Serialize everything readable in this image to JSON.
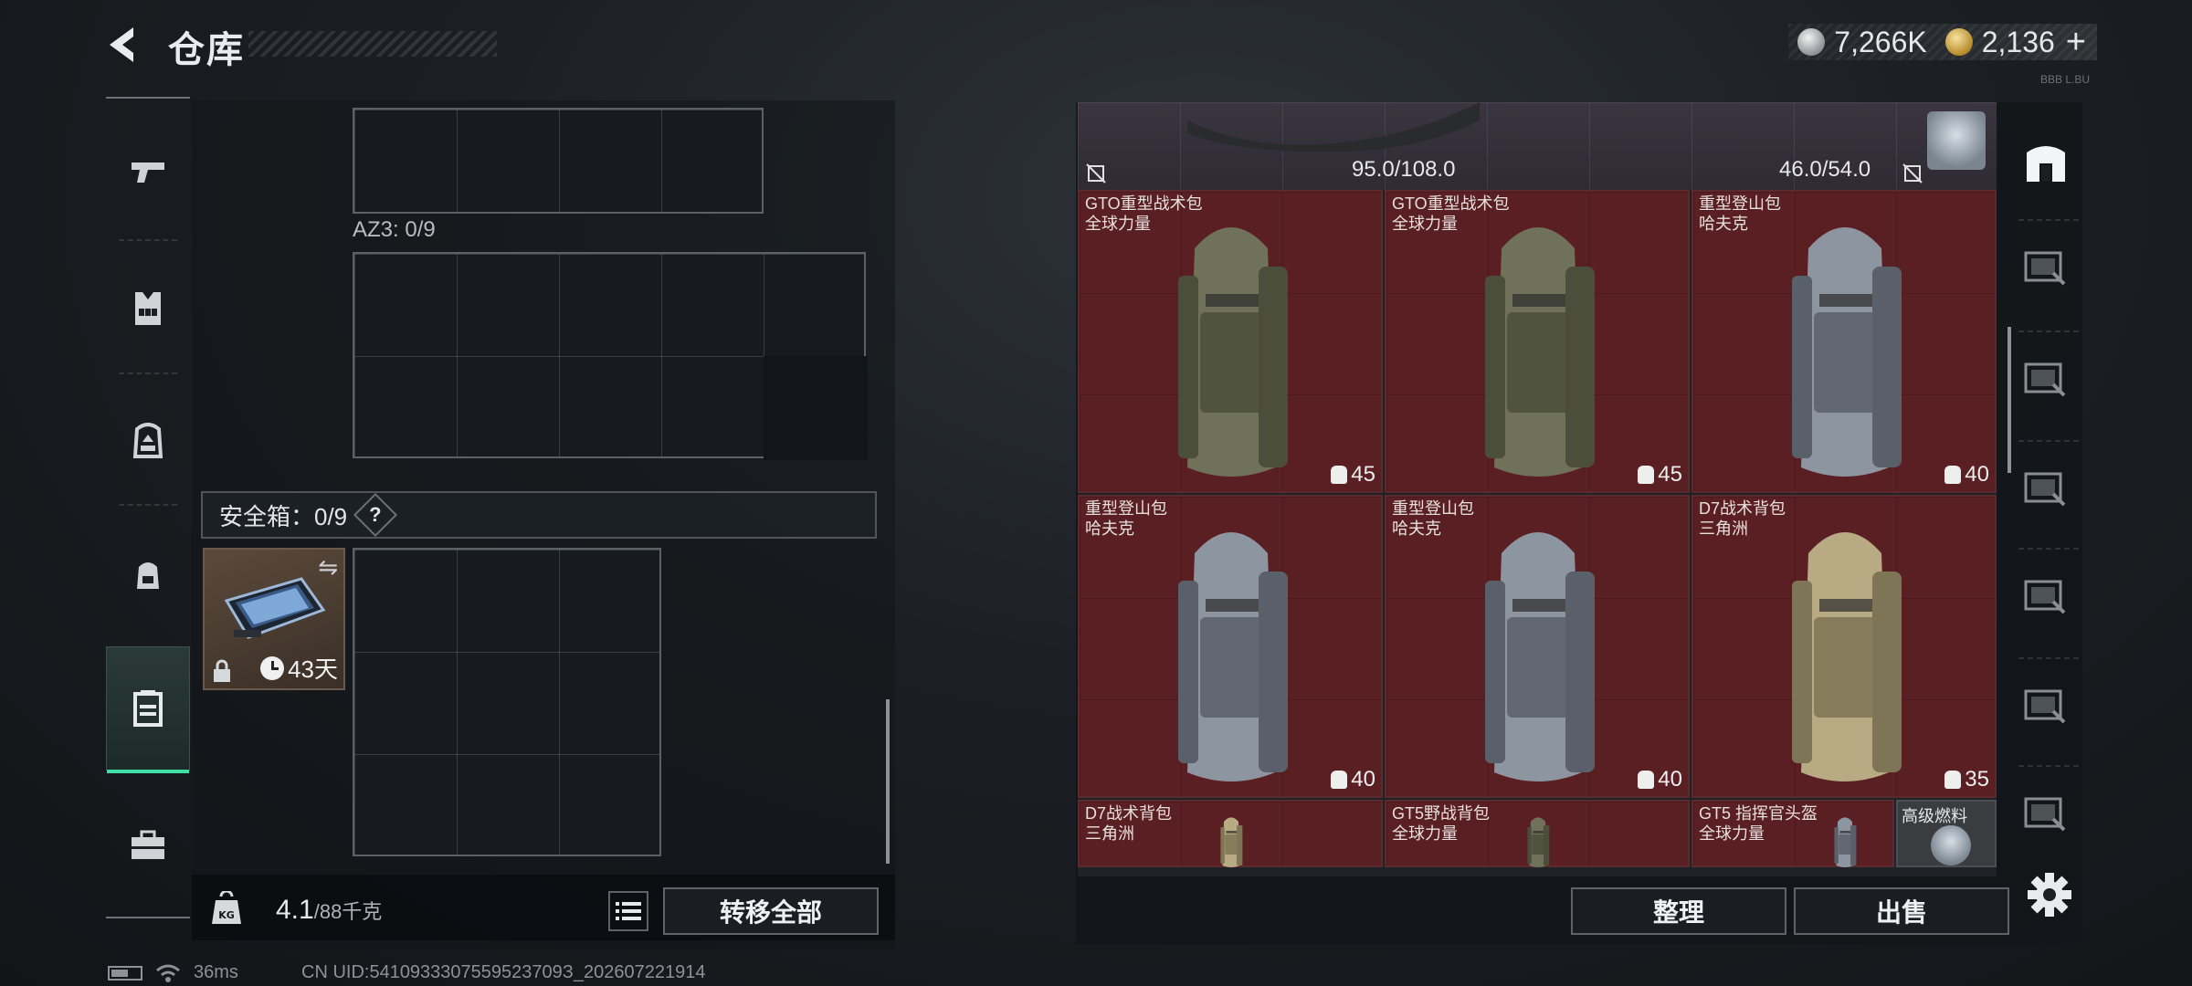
{
  "header": {
    "title": "仓库",
    "currency_silver": "7,266K",
    "currency_gold": "2,136",
    "plus_label": "+",
    "version": "BBB L.BU"
  },
  "left_rail": {
    "items": [
      {
        "name": "weapon",
        "icon": "pistol-icon"
      },
      {
        "name": "vest",
        "icon": "vest-icon"
      },
      {
        "name": "backpack",
        "icon": "backpack-icon"
      },
      {
        "name": "pouch",
        "icon": "small-backpack-icon"
      },
      {
        "name": "safe-box",
        "icon": "safebox-icon",
        "active": true
      },
      {
        "name": "toolbox",
        "icon": "toolbox-icon"
      }
    ]
  },
  "loadout": {
    "az3_label": "AZ3: 0/9",
    "safe_label": "安全箱：0/9",
    "safe_help": "?",
    "safe_item_timer": "43天",
    "weight_value": "4.1",
    "weight_max": "/88千克",
    "transfer_all": "转移全部"
  },
  "stash": {
    "capacity_left": "95.0/108.0",
    "capacity_right": "46.0/54.0",
    "items": [
      {
        "name": "GTO重型战术包",
        "brand": "全球力量",
        "capacity": "45",
        "color": "olive"
      },
      {
        "name": "GTO重型战术包",
        "brand": "全球力量",
        "capacity": "45",
        "color": "olive"
      },
      {
        "name": "重型登山包",
        "brand": "哈夫克",
        "capacity": "40",
        "color": "grey"
      },
      {
        "name": "重型登山包",
        "brand": "哈夫克",
        "capacity": "40",
        "color": "grey"
      },
      {
        "name": "重型登山包",
        "brand": "哈夫克",
        "capacity": "40",
        "color": "grey"
      },
      {
        "name": "D7战术背包",
        "brand": "三角洲",
        "capacity": "35",
        "color": "tan"
      },
      {
        "name": "D7战术背包",
        "brand": "三角洲",
        "capacity": "",
        "color": "tan"
      },
      {
        "name": "GT5野战背包",
        "brand": "全球力量",
        "capacity": "",
        "color": "olive"
      },
      {
        "name": "GT5 指挥官头盔",
        "brand": "全球力量",
        "capacity": "",
        "color": "grey"
      }
    ],
    "fuel_label": "高级燃料"
  },
  "right_rail": {
    "icons": [
      "home-icon",
      "video-card-icon",
      "stack-card-icon",
      "video-card-icon",
      "video-card-icon",
      "video-card-icon",
      "add-card-icon"
    ]
  },
  "actions": {
    "organize": "整理",
    "sell": "出售"
  },
  "status": {
    "ping": "36ms",
    "uid": "CN UID:5410933307559523709З_202607221914"
  }
}
